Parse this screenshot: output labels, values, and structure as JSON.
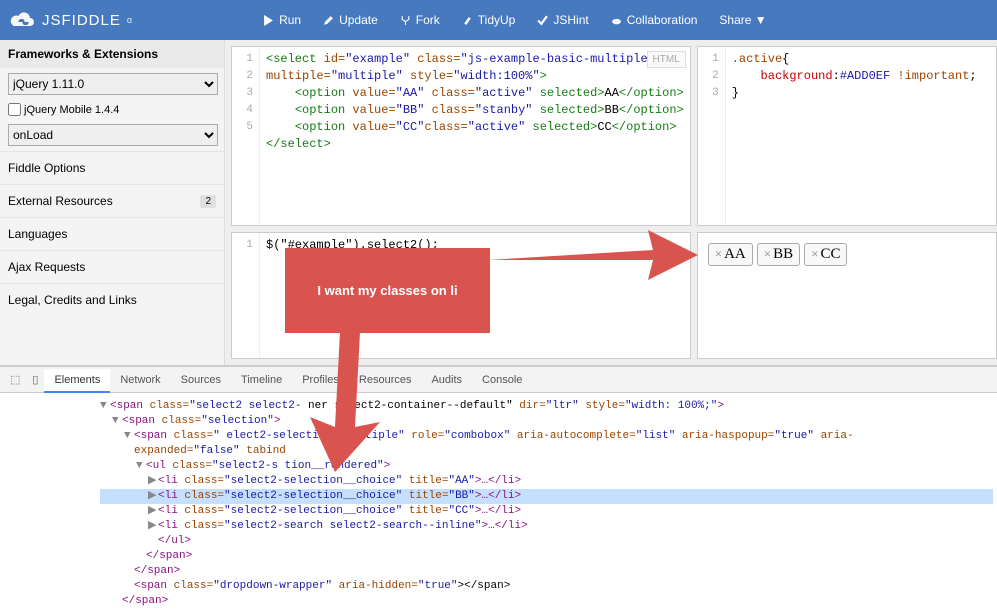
{
  "brand": "JSFIDDLE",
  "alpha": "α",
  "actions": {
    "run": "Run",
    "update": "Update",
    "fork": "Fork",
    "tidy": "TidyUp",
    "jshint": "JSHint",
    "collab": "Collaboration",
    "share": "Share ▼"
  },
  "sidebar": {
    "heading": "Frameworks & Extensions",
    "framework_value": "jQuery 1.11.0",
    "mobile_label": "jQuery Mobile 1.4.4",
    "onload_value": "onLoad",
    "items": [
      "Fiddle Options",
      "External Resources",
      "Languages",
      "Ajax Requests",
      "Legal, Credits and Links"
    ],
    "ext_badge": "2"
  },
  "panes": {
    "html_label": "HTML"
  },
  "html_code": {
    "l1": [
      "<select",
      " id=",
      "\"example\"",
      " class=",
      "\"js-example-basic-multiple\""
    ],
    "l2": [
      "multiple=",
      "\"multiple\"",
      " style=",
      "\"width:100%\"",
      ">"
    ],
    "l3": [
      "    ",
      "<option",
      " value=",
      "\"AA\"",
      " class=",
      "\"active\"",
      " selected>",
      "AA",
      "</option>"
    ],
    "l4": [
      "    ",
      "<option",
      " value=",
      "\"BB\"",
      " class=",
      "\"stanby\"",
      " selected>",
      "BB",
      "</option>"
    ],
    "l5": [
      "    ",
      "<option",
      " value=",
      "\"CC\"",
      "class=",
      "\"active\"",
      " selected>",
      "CC",
      "</option>"
    ],
    "l6": [
      "</select>"
    ]
  },
  "css_code": {
    "l1": ".active{",
    "l2": "    background:#ADD0EF !important;",
    "l3": "}"
  },
  "js_code": "$(\"#example\").select2();",
  "result": {
    "chips": [
      "AA",
      "BB",
      "CC"
    ]
  },
  "callout_text": "I want my classes on li",
  "devtools": {
    "tabs": [
      "Elements",
      "Network",
      "Sources",
      "Timeline",
      "Profiles",
      "Resources",
      "Audits",
      "Console"
    ],
    "active_tab": "Elements",
    "lines": [
      {
        "indent": 0,
        "caret": "▼",
        "parts": [
          "<span",
          " class=",
          "\"select2 select2-",
          "        ",
          "ner select2-container--default\"",
          " dir=",
          "\"ltr\"",
          " style=",
          "\"width: 100%;\"",
          ">"
        ]
      },
      {
        "indent": 1,
        "caret": "▼",
        "parts": [
          "<span",
          " class=",
          "\"selection\"",
          ">"
        ]
      },
      {
        "indent": 2,
        "caret": "▼",
        "parts": [
          "<span",
          " class=",
          "\"             elect2-selection--multiple\"",
          " role=",
          "\"combobox\"",
          " aria-autocomplete=",
          "\"list\"",
          " aria-haspopup=",
          "\"true\"",
          " aria-"
        ]
      },
      {
        "indent": 2,
        "caret": "",
        "parts": [
          "expanded=",
          "\"false\"",
          " tabind"
        ]
      },
      {
        "indent": 3,
        "caret": "▼",
        "parts": [
          "<ul",
          " class=",
          "\"select2-s    tion__rendered\"",
          ">"
        ]
      },
      {
        "indent": 4,
        "caret": "▶",
        "parts": [
          "<li",
          " class=",
          "\"select2-selection__choice\"",
          " title=",
          "\"AA\"",
          ">",
          "…",
          "</li>"
        ]
      },
      {
        "indent": 4,
        "caret": "▶",
        "hl": true,
        "parts": [
          "<li",
          " class=",
          "\"select2-selection__choice\"",
          " title=",
          "\"BB\"",
          ">",
          "…",
          "</li>"
        ]
      },
      {
        "indent": 4,
        "caret": "▶",
        "parts": [
          "<li",
          " class=",
          "\"select2-selection__choice\"",
          " title=",
          "\"CC\"",
          ">",
          "…",
          "</li>"
        ]
      },
      {
        "indent": 4,
        "caret": "▶",
        "parts": [
          "<li",
          " class=",
          "\"select2-search select2-search--inline\"",
          ">",
          "…",
          "</li>"
        ]
      },
      {
        "indent": 4,
        "caret": "",
        "parts": [
          "</ul>"
        ]
      },
      {
        "indent": 3,
        "caret": "",
        "parts": [
          "</span>"
        ]
      },
      {
        "indent": 2,
        "caret": "",
        "parts": [
          "</span>"
        ]
      },
      {
        "indent": 2,
        "caret": "",
        "parts": [
          "<span",
          " class=",
          "\"dropdown-wrapper\"",
          " aria-hidden=",
          "\"true\"",
          "></span>"
        ]
      },
      {
        "indent": 1,
        "caret": "",
        "parts": [
          "</span>"
        ]
      }
    ]
  }
}
